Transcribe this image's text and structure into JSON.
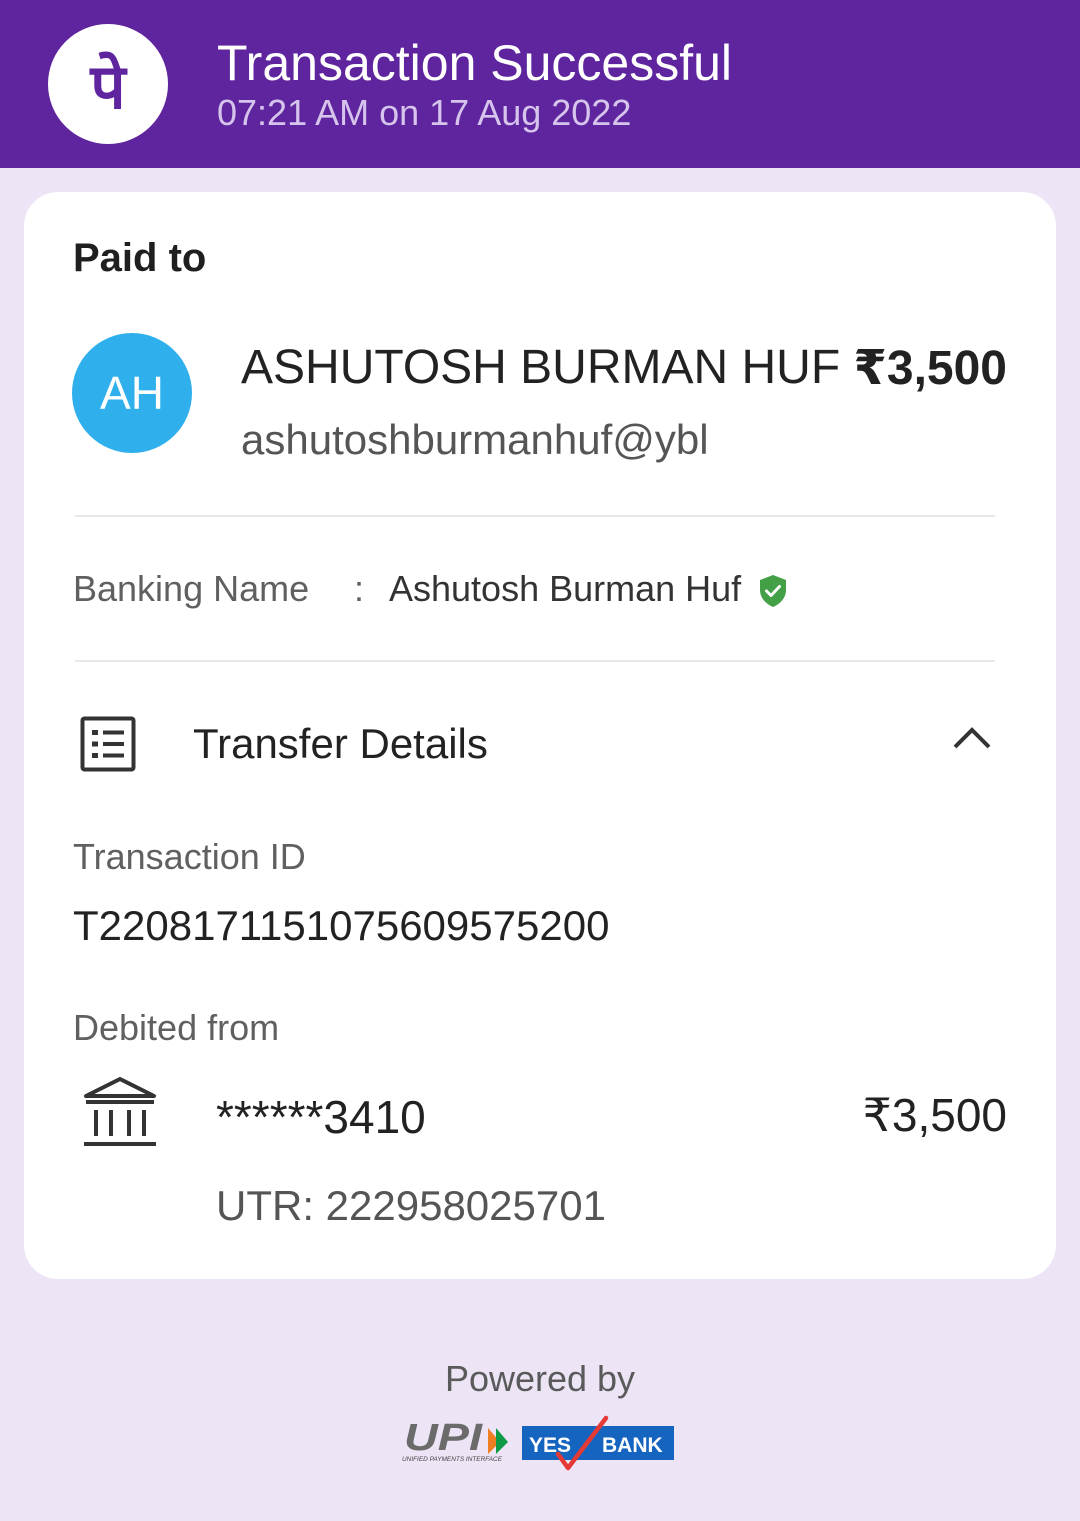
{
  "header": {
    "title": "Transaction Successful",
    "datetime": "07:21 AM on 17 Aug 2022",
    "brand_color": "#5f259f",
    "logo_glyph": "पे"
  },
  "payment": {
    "paid_to_label": "Paid to",
    "avatar_initials": "AH",
    "avatar_color": "#2fb0ec",
    "payee_name": "ASHUTOSH BURMAN HUF",
    "payee_upi": "ashutoshburmanhuf@ybl",
    "amount": "₹3,500"
  },
  "banking": {
    "label": "Banking Name",
    "separator": ":",
    "value": "Ashutosh Burman Huf",
    "verified_icon": "verified-shield-icon",
    "verified_color": "#43a047"
  },
  "transfer_details": {
    "title": "Transfer Details",
    "icon": "receipt-list-icon",
    "toggle_icon": "chevron-up-icon",
    "transaction_id_label": "Transaction ID",
    "transaction_id": "T2208171151075609575200",
    "debited_from_label": "Debited from",
    "account_icon": "bank-icon",
    "account_masked": "******3410",
    "debit_amount": "₹3,500",
    "utr": "UTR: 222958025701"
  },
  "footer": {
    "powered_by": "Powered by",
    "upi_logo_text": "UPI",
    "upi_tagline": "UNIFIED PAYMENTS INTERFACE",
    "bank_logo_yes": "YES",
    "bank_logo_bank": "BANK"
  }
}
